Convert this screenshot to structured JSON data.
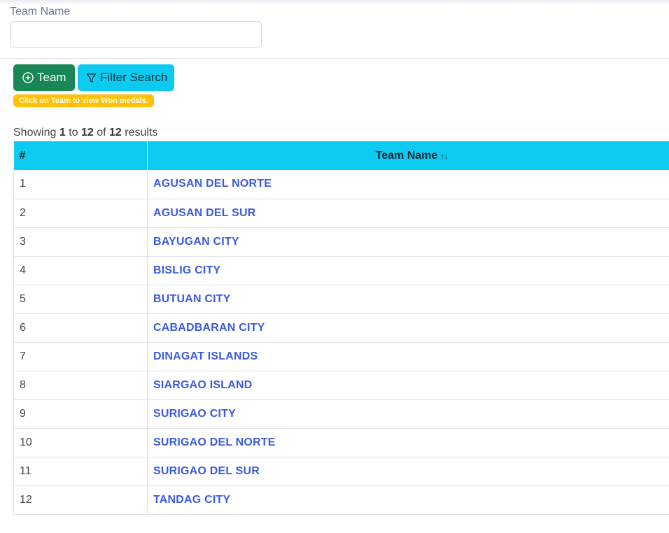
{
  "filter": {
    "label": "Team Name",
    "value": "",
    "placeholder": ""
  },
  "buttons": {
    "team_label": "Team",
    "filter_label": "Filter Search"
  },
  "hint": "Click on Team to view Won medals.",
  "summary": {
    "prefix": "Showing",
    "from": "1",
    "to_word": "to",
    "to": "12",
    "of_word": "of",
    "total": "12",
    "suffix": "results"
  },
  "table": {
    "headers": [
      "#",
      "Team Name"
    ],
    "sort_icon": "↑↓",
    "rows": [
      {
        "num": "1",
        "name": "AGUSAN DEL NORTE"
      },
      {
        "num": "2",
        "name": "AGUSAN DEL SUR"
      },
      {
        "num": "3",
        "name": "BAYUGAN CITY"
      },
      {
        "num": "4",
        "name": "BISLIG CITY"
      },
      {
        "num": "5",
        "name": "BUTUAN CITY"
      },
      {
        "num": "6",
        "name": "CABADBARAN CITY"
      },
      {
        "num": "7",
        "name": "DINAGAT ISLANDS"
      },
      {
        "num": "8",
        "name": "SIARGAO ISLAND"
      },
      {
        "num": "9",
        "name": "SURIGAO CITY"
      },
      {
        "num": "10",
        "name": "SURIGAO DEL NORTE"
      },
      {
        "num": "11",
        "name": "SURIGAO DEL SUR"
      },
      {
        "num": "12",
        "name": "TANDAG CITY"
      }
    ]
  },
  "colors": {
    "team_button": "#198754",
    "filter_button": "#0dcaf0",
    "table_header": "#0dcaf0",
    "badge": "#ffc107",
    "link": "#3b5bdb"
  }
}
